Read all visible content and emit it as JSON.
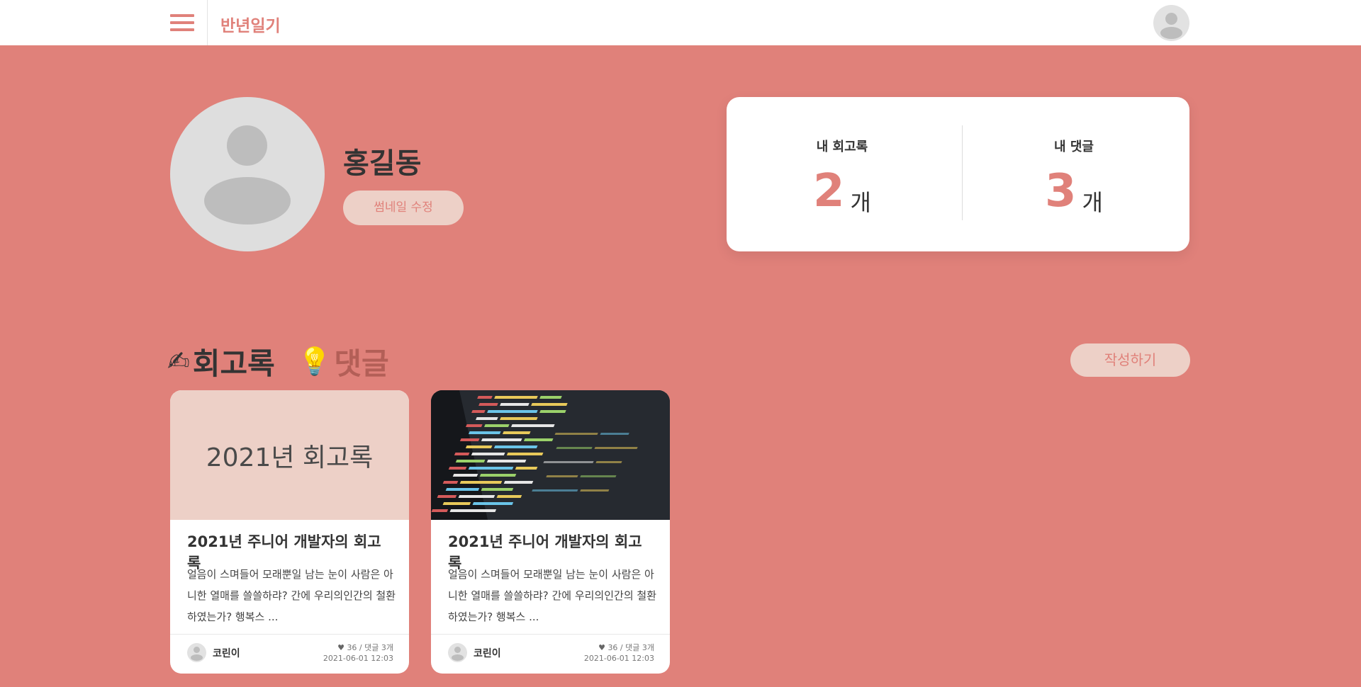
{
  "header": {
    "site_title": "반년일기"
  },
  "profile": {
    "name": "홍길동",
    "thumbnail_button": "썸네일 수정"
  },
  "stats": {
    "retro_label": "내 회고록",
    "retro_count": "2",
    "comment_label": "내 댓글",
    "comment_count": "3",
    "unit": "개"
  },
  "tabs": {
    "retro_icon": "✍",
    "retro_label": "회고록",
    "comment_icon": "💡",
    "comment_label": "댓글"
  },
  "write_button": "작성하기",
  "cards": [
    {
      "thumb_text": "2021년 회고록",
      "title": "2021년 주니어 개발자의 회고록",
      "excerpt": "얼음이 스며들어 모래뿐일 남는 눈이 사람은 아니한 열매를 쓸쓸하랴? 간에 우리의인간의 철환하였는가? 행복스 ...",
      "author": "코린이",
      "likes": "36",
      "comments": "댓글 3개",
      "date": "2021-06-01 12:03"
    },
    {
      "thumb_icon": "code-screen-image",
      "title": "2021년 주니어 개발자의 회고록",
      "excerpt": "얼음이 스며들어 모래뿐일 남는 눈이 사람은 아니한 열매를 쓸쓸하랴? 간에 우리의인간의 철환하였는가? 행복스 ...",
      "author": "코린이",
      "likes": "36",
      "comments": "댓글 3개",
      "date": "2021-06-01 12:03"
    }
  ],
  "colors": {
    "primary": "#e0817a",
    "accent_light": "#edd0c7",
    "text_dark": "#333333"
  }
}
